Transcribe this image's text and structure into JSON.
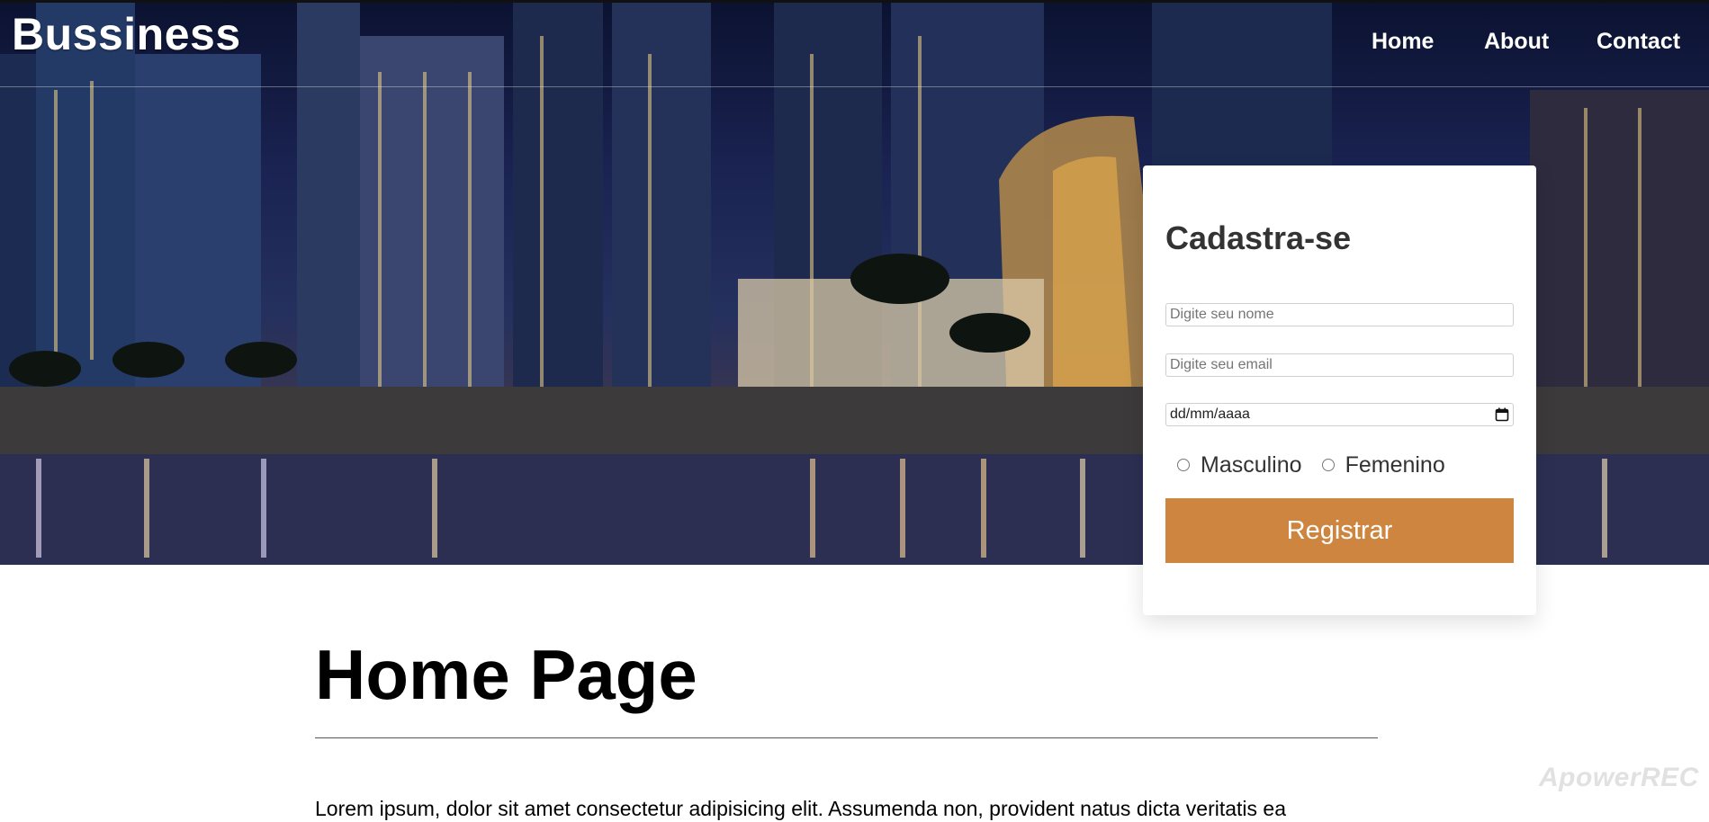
{
  "brand": {
    "name": "Bussiness"
  },
  "nav": {
    "items": [
      "Home",
      "About",
      "Contact"
    ]
  },
  "form": {
    "title": "Cadastra-se",
    "name_placeholder": "Digite seu nome",
    "email_placeholder": "Digite seu email",
    "date_placeholder": "dd/mm/aaaa",
    "gender_options": [
      "Masculino",
      "Femenino"
    ],
    "submit_label": "Registrar"
  },
  "content": {
    "title": "Home Page",
    "paragraph": "Lorem ipsum, dolor sit amet consectetur adipisicing elit. Assumenda non, provident natus dicta veritatis ea"
  },
  "watermark": "ApowerREC",
  "colors": {
    "accent": "#cd853f",
    "card_bg": "#ffffff",
    "hero_dark": "#0b1230"
  }
}
